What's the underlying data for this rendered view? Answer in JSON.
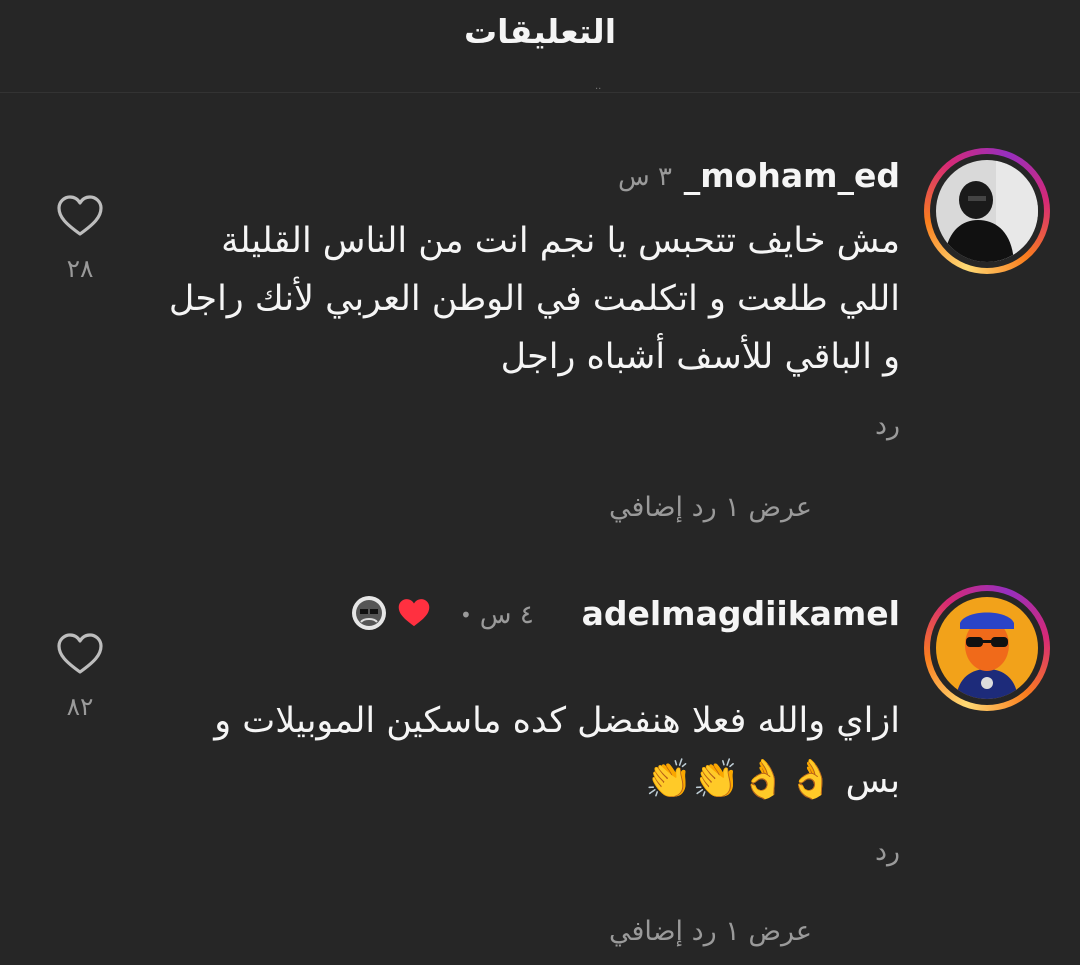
{
  "header": {
    "title": "التعليقات"
  },
  "comments": [
    {
      "username": "_moham_ed",
      "time": "٣ س",
      "text": "مش خايف تتحبس يا نجم انت من الناس القليلة اللي طلعت و اتكلمت في الوطن العربي لأنك راجل و الباقي للأسف أشباه راجل",
      "reply_label": "رد",
      "view_replies": "عرض ١ رد إضافي",
      "like_count": "٢٨",
      "avatar_icon": "profile-photo-dark"
    },
    {
      "username": "adelmagdiikamel",
      "time": "٤ س",
      "separator": "•",
      "text": "ازاي والله فعلا هنفضل كده ماسكين الموبيلات و بس",
      "emojis": "👌👌👏👏",
      "reply_label": "رد",
      "view_replies": "عرض ١ رد إضافي",
      "like_count": "٨٢",
      "avatar_icon": "cartoon-avatar",
      "liked_by_creator_icon": "heart-icon",
      "creator_avatar_icon": "small-avatar"
    }
  ],
  "colors": {
    "background": "#262626",
    "text": "#f5f5f5",
    "secondary_text": "#9a9a9a",
    "heart_red": "#ff3040"
  }
}
